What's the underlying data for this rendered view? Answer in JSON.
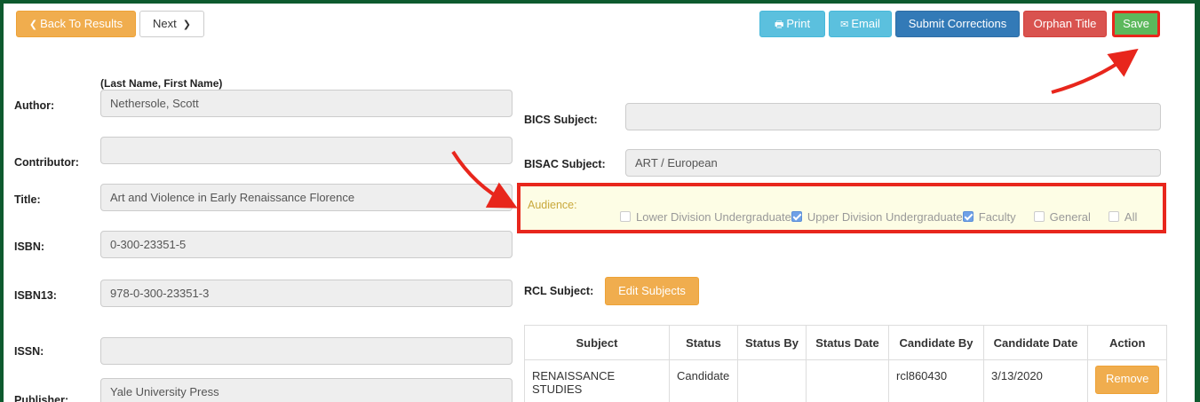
{
  "toolbar": {
    "back_label": "Back To Results",
    "next_label": "Next",
    "print_label": "Print",
    "email_label": "Email",
    "submit_label": "Submit Corrections",
    "orphan_label": "Orphan Title",
    "save_label": "Save"
  },
  "form_left": {
    "name_hint": "(Last Name, First Name)",
    "author_label": "Author:",
    "author_value": "Nethersole, Scott",
    "contributor_label": "Contributor:",
    "contributor_value": "",
    "title_label": "Title:",
    "title_value": "Art and Violence in Early Renaissance Florence",
    "isbn_label": "ISBN:",
    "isbn_value": "0-300-23351-5",
    "isbn13_label": "ISBN13:",
    "isbn13_value": "978-0-300-23351-3",
    "issn_label": "ISSN:",
    "issn_value": "",
    "publisher_label": "Publisher:",
    "publisher_value": "Yale University Press"
  },
  "form_right": {
    "bics_label": "BICS Subject:",
    "bics_value": "",
    "bisac_label": "BISAC Subject:",
    "bisac_value": "ART / European",
    "audience_label": "Audience:",
    "audience_options": [
      {
        "label": "Lower Division Undergraduate",
        "checked": false
      },
      {
        "label": "Upper Division Undergraduate",
        "checked": true
      },
      {
        "label": "Faculty",
        "checked": true
      },
      {
        "label": "General",
        "checked": false
      },
      {
        "label": "All",
        "checked": false
      }
    ],
    "rcl_label": "RCL Subject:",
    "edit_subjects_label": "Edit Subjects"
  },
  "subjects_table": {
    "headers": [
      "Subject",
      "Status",
      "Status By",
      "Status Date",
      "Candidate By",
      "Candidate Date",
      "Action"
    ],
    "rows": [
      {
        "subject": "RENAISSANCE STUDIES",
        "status": "Candidate",
        "status_by": "",
        "status_date": "",
        "candidate_by": "rcl860430",
        "candidate_date": "3/13/2020",
        "action_label": "Remove"
      }
    ]
  },
  "colors": {
    "highlight_border": "#e8261c",
    "annotation_arrow": "#e8261c",
    "save_button": "#5cb85c"
  }
}
